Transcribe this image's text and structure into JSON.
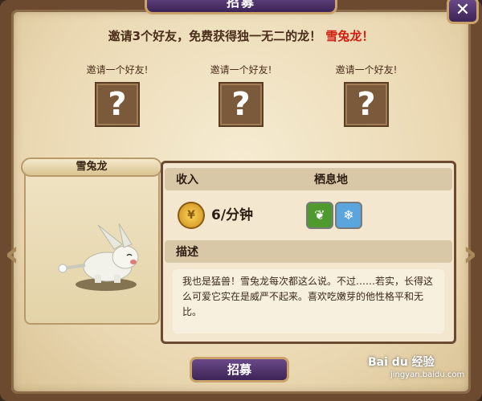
{
  "window": {
    "title": "招募",
    "close_glyph": "✕"
  },
  "invite": {
    "prefix": "邀请3个好友，免费获得独一无二的龙！",
    "dragon_name": "雪兔龙",
    "suffix": "！"
  },
  "slots": [
    {
      "label": "邀请一个好友!",
      "glyph": "?"
    },
    {
      "label": "邀请一个好友!",
      "glyph": "?"
    },
    {
      "label": "邀请一个好友!",
      "glyph": "?"
    }
  ],
  "nav": {
    "left_glyph": "‹",
    "right_glyph": "›"
  },
  "dragon_card": {
    "name": "雪兔龙"
  },
  "info": {
    "income_header": "收入",
    "habitat_header": "栖息地",
    "income_value": "6/分钟",
    "habitats": [
      {
        "icon": "leaf-icon",
        "glyph": "❦",
        "color": "#4f9a2f"
      },
      {
        "icon": "snowflake-icon",
        "glyph": "❄",
        "color": "#5aa5dd"
      }
    ],
    "desc_header": "描述",
    "description": "我也是猛兽！雪兔龙每次都这么说。不过……若实，长得这么可爱它实在是威严不起来。喜欢吃嫩芽的他性格平和无比。"
  },
  "actions": {
    "recruit_label": "招募"
  },
  "watermark": {
    "brand": "Bai du 经验",
    "url": "jingyan.baidu.com"
  }
}
